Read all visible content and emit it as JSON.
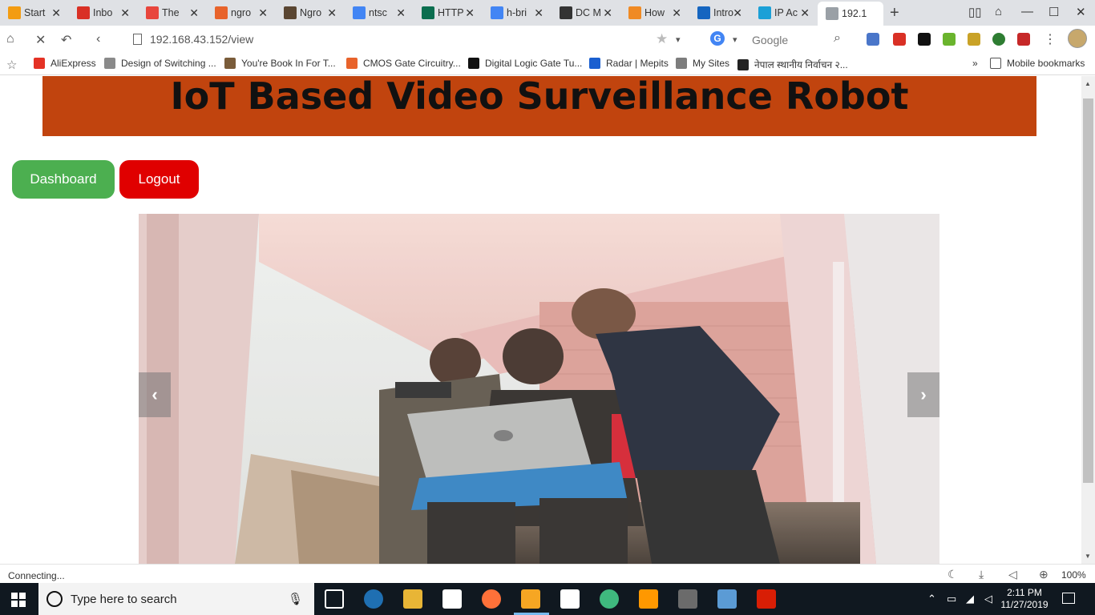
{
  "browser": {
    "tabs": [
      {
        "title": "Start",
        "icon": "start-icon",
        "color": "#f39c12",
        "active": false
      },
      {
        "title": "Inbo",
        "icon": "gmail-icon",
        "color": "#d93025",
        "active": false
      },
      {
        "title": "The",
        "icon": "udemy-icon",
        "color": "#e8453c",
        "active": false
      },
      {
        "title": "ngro",
        "icon": "ngrok-icon",
        "color": "#e8632b",
        "active": false
      },
      {
        "title": "Ngro",
        "icon": "ngrok-box-icon",
        "color": "#5a4632",
        "active": false
      },
      {
        "title": "ntsc",
        "icon": "google-icon",
        "color": "#4285f4",
        "active": false
      },
      {
        "title": "HTTP",
        "icon": "http-icon",
        "color": "#0b6e4f",
        "active": false
      },
      {
        "title": "h-bri",
        "icon": "google-icon",
        "color": "#4285f4",
        "active": false
      },
      {
        "title": "DC M",
        "icon": "fire-icon",
        "color": "#333333",
        "active": false
      },
      {
        "title": "How",
        "icon": "instructables-icon",
        "color": "#f08a24",
        "active": false
      },
      {
        "title": "Intro",
        "icon": "tutorial-icon",
        "color": "#1565c0",
        "active": false
      },
      {
        "title": "IP Ac",
        "icon": "cisco-icon",
        "color": "#1ba0d7",
        "active": false
      },
      {
        "title": "192.1",
        "icon": "loading-icon",
        "color": "#9aa0a6",
        "active": true
      }
    ],
    "close_glyph": "✕",
    "new_tab_glyph": "+",
    "url": "192.168.43.152/view",
    "search_engine_label": "Google",
    "bookmarks": [
      {
        "label": "AliExpress",
        "icon": "aliexpress-icon",
        "color": "#e43225"
      },
      {
        "label": "Design of Switching ...",
        "icon": "page-icon",
        "color": "#8a8a8a"
      },
      {
        "label": "You're Book In For T...",
        "icon": "book-icon",
        "color": "#7a5c3a"
      },
      {
        "label": "CMOS Gate Circuitry...",
        "icon": "chip-icon",
        "color": "#e8632b"
      },
      {
        "label": "Digital Logic Gate Tu...",
        "icon": "logic-icon",
        "color": "#111111"
      },
      {
        "label": "Radar | Mepits",
        "icon": "mepits-icon",
        "color": "#1a5fd0"
      },
      {
        "label": "My Sites",
        "icon": "folder-icon",
        "color": "#7d7d7d"
      },
      {
        "label": "नेपाल स्थानीय निर्वाचन २...",
        "icon": "election-icon",
        "color": "#222222"
      }
    ],
    "bookmarks_overflow": "»",
    "mobile_bookmarks": "Mobile bookmarks",
    "status": "Connecting...",
    "zoom": "100%"
  },
  "page": {
    "title": "IoT Based Video Surveillance Robot",
    "dashboard_button": "Dashboard",
    "logout_button": "Logout",
    "prev_glyph": "‹",
    "next_glyph": "›"
  },
  "taskbar": {
    "search_placeholder": "Type here to search",
    "time": "2:11 PM",
    "date": "11/27/2019"
  },
  "colors": {
    "banner": "#c1440e",
    "dashboard": "#4caf50",
    "logout": "#e00000"
  }
}
